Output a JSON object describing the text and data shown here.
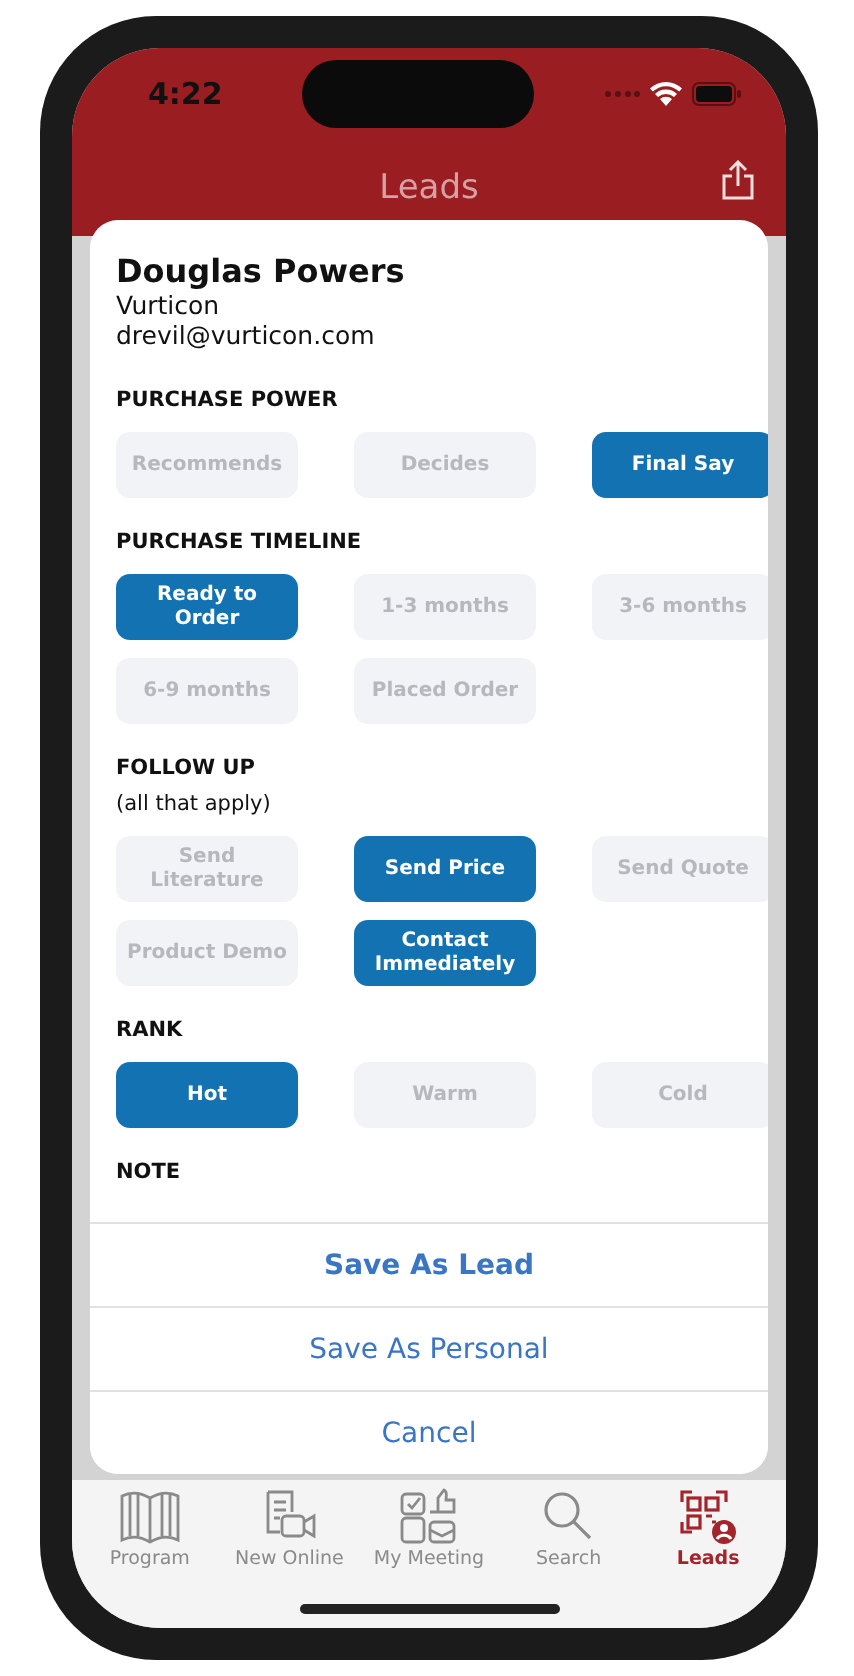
{
  "status_bar": {
    "time": "4:22"
  },
  "nav": {
    "title": "Leads"
  },
  "lead": {
    "name": "Douglas Powers",
    "company": "Vurticon",
    "email": "drevil@vurticon.com"
  },
  "sections": [
    {
      "title": "PURCHASE POWER",
      "options": [
        {
          "label": "Recommends",
          "selected": false
        },
        {
          "label": "Decides",
          "selected": false
        },
        {
          "label": "Final Say",
          "selected": true
        }
      ]
    },
    {
      "title": "PURCHASE TIMELINE",
      "options": [
        {
          "label": "Ready to Order",
          "selected": true
        },
        {
          "label": "1-3 months",
          "selected": false
        },
        {
          "label": "3-6 months",
          "selected": false
        },
        {
          "label": "6-9 months",
          "selected": false
        },
        {
          "label": "Placed Order",
          "selected": false
        }
      ]
    },
    {
      "title": "FOLLOW UP",
      "subtitle": "(all that apply)",
      "options": [
        {
          "label": "Send Literature",
          "selected": false
        },
        {
          "label": "Send Price",
          "selected": true
        },
        {
          "label": "Send Quote",
          "selected": false
        },
        {
          "label": "Product Demo",
          "selected": false
        },
        {
          "label": "Contact Immediately",
          "selected": true
        }
      ]
    },
    {
      "title": "RANK",
      "options": [
        {
          "label": "Hot",
          "selected": true
        },
        {
          "label": "Warm",
          "selected": false
        },
        {
          "label": "Cold",
          "selected": false
        }
      ]
    },
    {
      "title": "NOTE"
    }
  ],
  "actions": [
    {
      "label": "Save As Lead",
      "kind": "primary"
    },
    {
      "label": "Save As Personal",
      "kind": "secondary"
    },
    {
      "label": "Cancel",
      "kind": "secondary"
    }
  ],
  "tab_bar": [
    {
      "label": "Program",
      "kind": "book",
      "selected": false
    },
    {
      "label": "New Online",
      "kind": "video",
      "selected": false
    },
    {
      "label": "My Meeting",
      "kind": "meeting",
      "selected": false
    },
    {
      "label": "Search",
      "kind": "search",
      "selected": false
    },
    {
      "label": "Leads",
      "kind": "qr",
      "selected": true
    }
  ]
}
